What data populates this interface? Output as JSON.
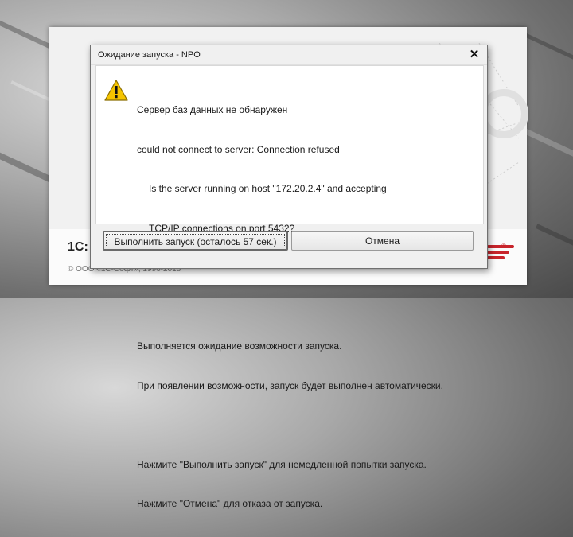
{
  "splash": {
    "logo_text": "1С:",
    "copyright": "© ООО «1С-Софт», 1996-2018"
  },
  "dialog": {
    "title": "Ожидание запуска - NPO",
    "close_glyph": "✕",
    "icon": "warning-icon",
    "message_lines": [
      "Сервер баз данных не обнаружен",
      "could not connect to server: Connection refused",
      "Is the server running on host \"172.20.2.4\" and accepting",
      "TCP/IP connections on port 5432?",
      "",
      "",
      "Выполняется ожидание возможности запуска.",
      "При появлении возможности, запуск будет выполнен автоматически.",
      "",
      "Нажмите \"Выполнить запуск\" для немедленной попытки запуска.",
      "Нажмите \"Отмена\" для отказа от запуска."
    ],
    "buttons": {
      "run_label": "Выполнить запуск (осталось 57 сек.)",
      "cancel_label": "Отмена"
    }
  },
  "colors": {
    "warning_yellow": "#f5c400",
    "brand_red": "#c8242b"
  }
}
